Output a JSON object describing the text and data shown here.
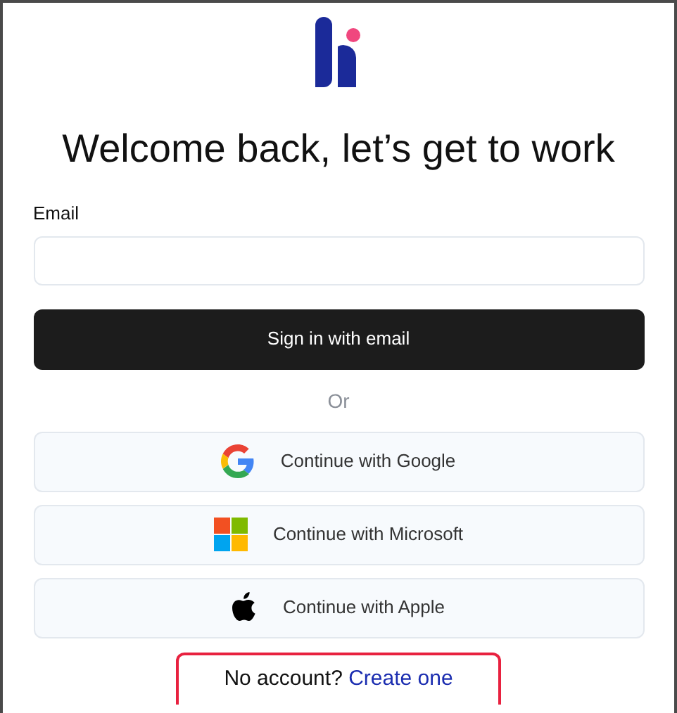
{
  "heading": "Welcome back, let’s get to work",
  "email": {
    "label": "Email"
  },
  "sign_in_button": "Sign in with email",
  "divider": "Or",
  "providers": [
    {
      "kind": "google",
      "label": "Continue with Google"
    },
    {
      "kind": "microsoft",
      "label": "Continue with Microsoft"
    },
    {
      "kind": "apple",
      "label": "Continue with Apple"
    }
  ],
  "signup": {
    "prompt": "No account?",
    "link": "Create one"
  }
}
